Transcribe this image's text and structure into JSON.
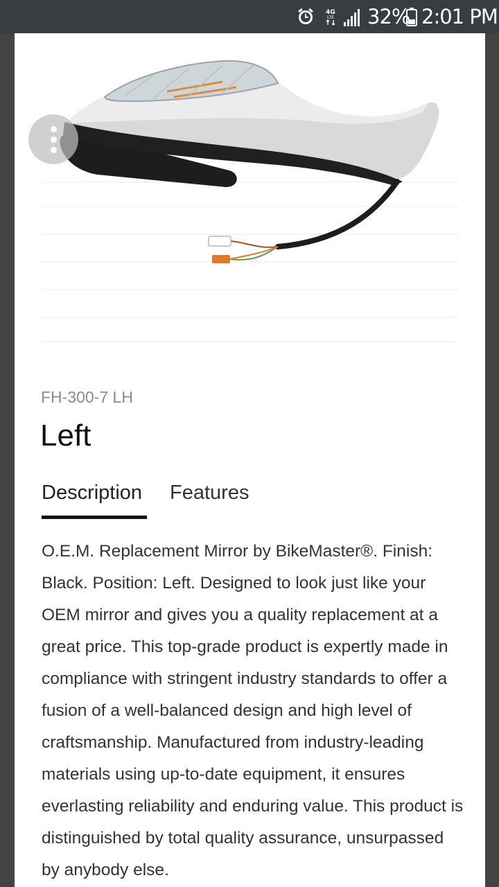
{
  "status_bar": {
    "battery_percent": "32%",
    "time": "2:01 PM",
    "network_type": "4G LTE",
    "icons": [
      "alarm-icon",
      "network-4g-icon",
      "signal-icon",
      "battery-icon"
    ]
  },
  "product": {
    "image_icon": "motorcycle-mirror-image",
    "more_icon": "more-vertical-icon",
    "sku": "FH-300-7 LH",
    "title": "Left"
  },
  "tabs": [
    {
      "label": "Description",
      "selected": true
    },
    {
      "label": "Features",
      "selected": false
    }
  ],
  "description": "O.E.M. Replacement Mirror by BikeMaster®. Finish: Black. Position: Left. Designed to look just like your OEM mirror and gives you a quality replacement at a great price. This top-grade product is expertly made in compliance with stringent industry standards to offer a fusion of a well-balanced design and high level of craftsmanship. Manufactured from industry-leading materials using up-to-date equipment, it ensures everlasting reliability and enduring value. This product is distinguished by total quality assurance, unsurpassed by anybody else.",
  "colors": {
    "status_bar": "#3a3d40",
    "background": "#434343",
    "sheet": "#ffffff",
    "text_primary": "#111111",
    "text_secondary": "#8a8a8a"
  }
}
